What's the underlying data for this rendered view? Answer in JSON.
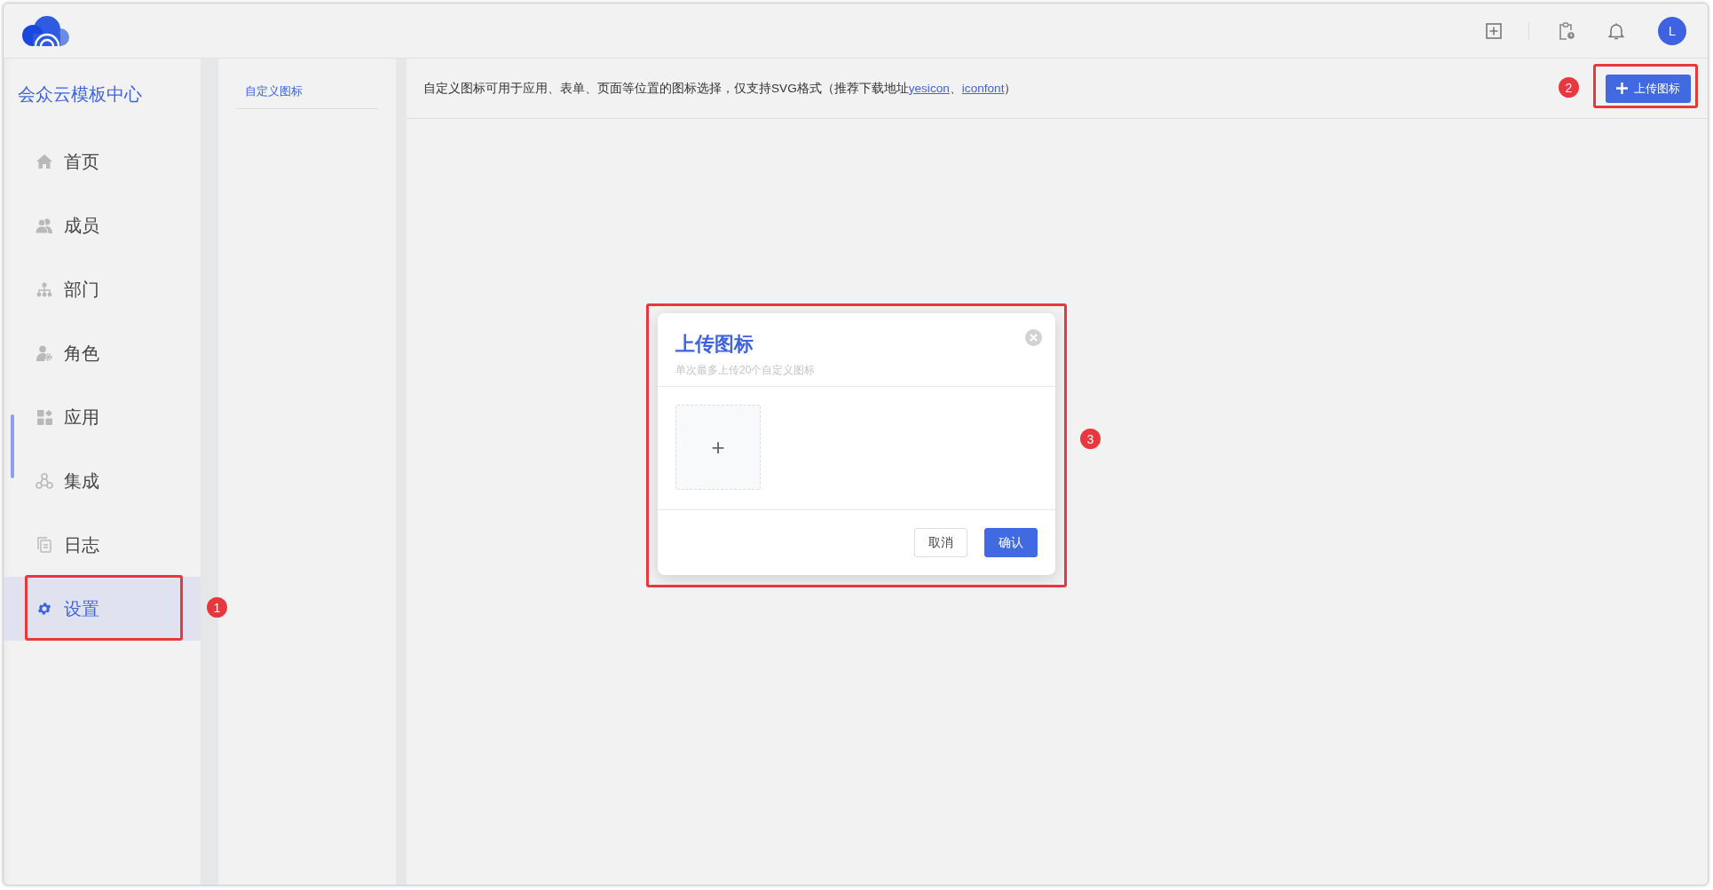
{
  "header": {
    "avatar_letter": "L"
  },
  "sidebar": {
    "title": "会众云模板中心",
    "items": [
      {
        "label": "首页",
        "selected": false
      },
      {
        "label": "成员",
        "selected": false
      },
      {
        "label": "部门",
        "selected": false
      },
      {
        "label": "角色",
        "selected": false
      },
      {
        "label": "应用",
        "selected": false
      },
      {
        "label": "集成",
        "selected": false
      },
      {
        "label": "日志",
        "selected": false
      },
      {
        "label": "设置",
        "selected": true
      }
    ]
  },
  "subnav": {
    "items": [
      {
        "label": "自定义图标",
        "selected": true
      }
    ]
  },
  "main": {
    "notice": [
      {
        "kind": "text",
        "text": "自定义图标可用于应用、表单、页面等位置的图标选择，仅支持SVG格式（推荐下载地址"
      },
      {
        "kind": "link",
        "text": "yesicon"
      },
      {
        "kind": "text",
        "text": "、"
      },
      {
        "kind": "link",
        "text": "iconfont"
      },
      {
        "kind": "text",
        "text": "）"
      }
    ],
    "upload_button": "上传图标"
  },
  "dialog": {
    "title": "上传图标",
    "subtitle": "单次最多上传20个自定义图标",
    "upload_tile": "+",
    "buttons": [
      {
        "label": "取消",
        "kind": "secondary"
      },
      {
        "label": "确认",
        "kind": "primary"
      }
    ]
  },
  "annotations": [
    {
      "label": "1"
    },
    {
      "label": "2"
    },
    {
      "label": "3"
    }
  ]
}
